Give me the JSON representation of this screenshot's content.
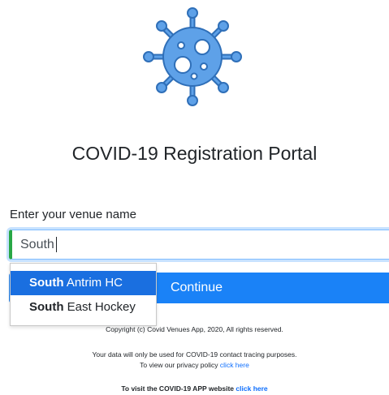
{
  "header": {
    "title": "COVID-19 Registration Portal"
  },
  "form": {
    "label": "Enter your venue name",
    "value": "South",
    "submit_label": "Continue"
  },
  "autocomplete": {
    "items": [
      {
        "match": "South",
        "rest": " Antrim HC"
      },
      {
        "match": "South",
        "rest": " East Hockey"
      }
    ]
  },
  "footer": {
    "copyright": "Copyright (c) Covid Venues App, 2020, All rights reserved.",
    "data_use": "Your data will only be used for COVID-19 contact tracing purposes.",
    "privacy_prefix": "To view our privacy policy",
    "privacy_link": "click here",
    "visit_prefix": "To visit the COVID-19 APP website",
    "visit_link": "click here"
  },
  "colors": {
    "accent": "#1a82f7",
    "virus": "#5ea1e8",
    "input_border_left": "#28a745"
  },
  "icons": {
    "logo": "virus-icon"
  }
}
